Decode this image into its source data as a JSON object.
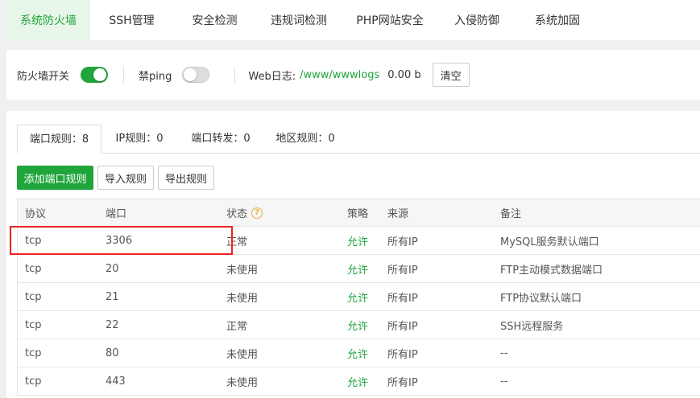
{
  "topnav": {
    "tabs": [
      {
        "label": "系统防火墙",
        "active": true
      },
      {
        "label": "SSH管理"
      },
      {
        "label": "安全检测"
      },
      {
        "label": "违规词检测"
      },
      {
        "label": "PHP网站安全"
      },
      {
        "label": "入侵防御"
      },
      {
        "label": "系统加固"
      }
    ]
  },
  "switches": {
    "firewall_label": "防火墙开关",
    "firewall_on": true,
    "ping_label": "禁ping",
    "ping_on": false,
    "weblog_label": "Web日志:",
    "weblog_path": "/www/wwwlogs",
    "weblog_size": "0.00 b",
    "clear_label": "清空"
  },
  "subtabs": [
    {
      "label": "端口规则：8",
      "active": true
    },
    {
      "label": "IP规则：0"
    },
    {
      "label": "端口转发：0"
    },
    {
      "label": "地区规则：0"
    }
  ],
  "actions": {
    "add": "添加端口规则",
    "import": "导入规则",
    "export": "导出规则"
  },
  "table": {
    "headers": {
      "protocol": "协议",
      "port": "端口",
      "status": "状态",
      "policy": "策略",
      "source": "来源",
      "note": "备注"
    },
    "rows": [
      {
        "protocol": "tcp",
        "port": "3306",
        "status": "正常",
        "policy": "允许",
        "source": "所有IP",
        "note": "MySQL服务默认端口"
      },
      {
        "protocol": "tcp",
        "port": "20",
        "status": "未使用",
        "policy": "允许",
        "source": "所有IP",
        "note": "FTP主动模式数据端口"
      },
      {
        "protocol": "tcp",
        "port": "21",
        "status": "未使用",
        "policy": "允许",
        "source": "所有IP",
        "note": "FTP协议默认端口"
      },
      {
        "protocol": "tcp",
        "port": "22",
        "status": "正常",
        "policy": "允许",
        "source": "所有IP",
        "note": "SSH远程服务"
      },
      {
        "protocol": "tcp",
        "port": "80",
        "status": "未使用",
        "policy": "允许",
        "source": "所有IP",
        "note": "--"
      },
      {
        "protocol": "tcp",
        "port": "443",
        "status": "未使用",
        "policy": "允许",
        "source": "所有IP",
        "note": "--"
      }
    ]
  },
  "colors": {
    "accent": "#20a53a",
    "highlight": "#e22222",
    "help": "#f0ad4e"
  }
}
